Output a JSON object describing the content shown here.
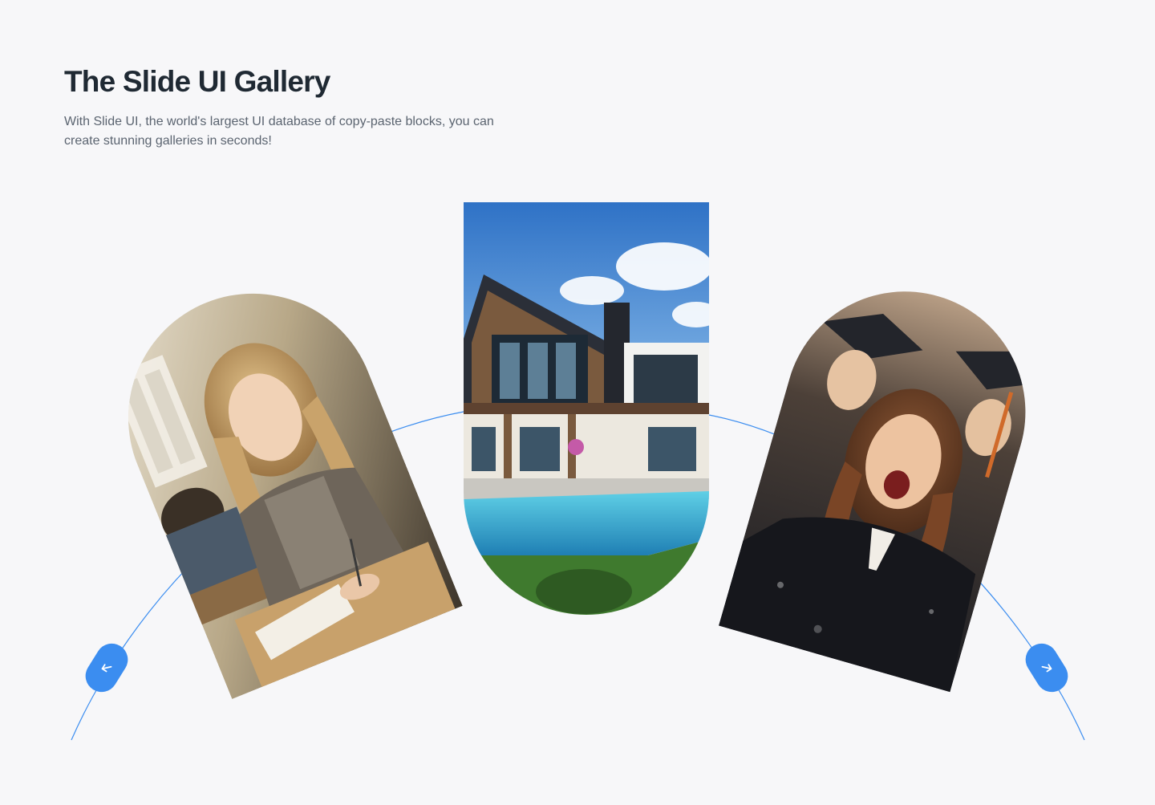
{
  "header": {
    "title": "The Slide UI Gallery",
    "subtitle": "With Slide UI, the world's largest UI database of copy-paste blocks, you can create stunning galleries in seconds!"
  },
  "gallery": {
    "slides": [
      {
        "id": "student",
        "icon": "studying-student-photo"
      },
      {
        "id": "house",
        "icon": "modern-house-pool-photo"
      },
      {
        "id": "graduates",
        "icon": "celebrating-graduates-photo"
      }
    ]
  },
  "controls": {
    "prev_icon": "arrow-down-left-icon",
    "next_icon": "arrow-down-right-icon",
    "accent_color": "#3b8df0"
  },
  "colors": {
    "background": "#f7f7f9",
    "heading": "#1f2933",
    "body_text": "#5b6470",
    "arc": "#3b8df0"
  }
}
